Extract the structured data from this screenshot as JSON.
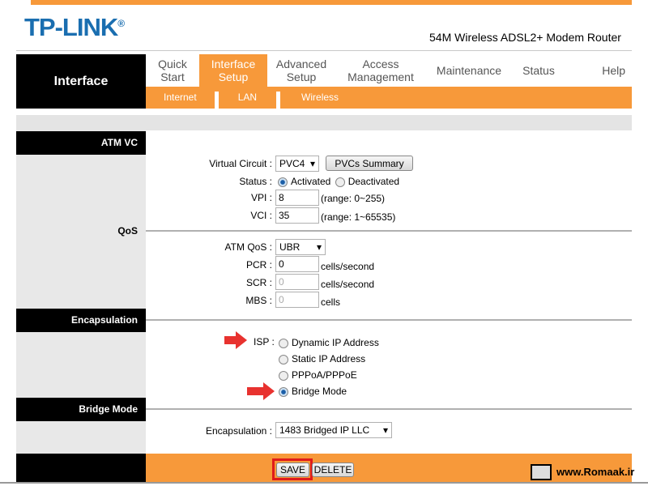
{
  "header": {
    "logo": "TP-LINK",
    "registered": "®",
    "subtitle": "54M Wireless ADSL2+ Modem Router"
  },
  "nav": {
    "section": "Interface",
    "tabs": [
      {
        "line1": "Quick",
        "line2": "Start"
      },
      {
        "line1": "Interface",
        "line2": "Setup"
      },
      {
        "line1": "Advanced",
        "line2": "Setup"
      },
      {
        "line1": "Access",
        "line2": "Management"
      },
      {
        "line1": "Maintenance",
        "line2": ""
      },
      {
        "line1": "Status",
        "line2": ""
      },
      {
        "line1": "Help",
        "line2": ""
      }
    ],
    "subtabs": [
      "Internet",
      "LAN",
      "Wireless"
    ]
  },
  "sections": {
    "atmvc": "ATM VC",
    "qos": "QoS",
    "encapsulation": "Encapsulation",
    "bridge": "Bridge Mode"
  },
  "atmvc": {
    "vc_label": "Virtual Circuit :",
    "vc_value": "PVC4",
    "pvcs_button": "PVCs Summary",
    "status_label": "Status :",
    "activated": "Activated",
    "deactivated": "Deactivated",
    "vpi_label": "VPI :",
    "vpi": "8",
    "vpi_range": "(range: 0~255)",
    "vci_label": "VCI :",
    "vci": "35",
    "vci_range": "(range: 1~65535)"
  },
  "qos": {
    "atmqos_label": "ATM QoS :",
    "atmqos": "UBR",
    "pcr_label": "PCR :",
    "pcr": "0",
    "scr_label": "SCR :",
    "scr": "0",
    "mbs_label": "MBS :",
    "mbs": "0",
    "unit_cps": "cells/second",
    "unit_cells": "cells"
  },
  "isp": {
    "label": "ISP :",
    "options": [
      "Dynamic IP Address",
      "Static IP Address",
      "PPPoA/PPPoE",
      "Bridge Mode"
    ],
    "selected": "Bridge Mode"
  },
  "bridge": {
    "encap_label": "Encapsulation :",
    "encap_value": "1483 Bridged IP LLC"
  },
  "footer": {
    "save": "SAVE",
    "delete": "DELETE",
    "watermark": "www.Romaak.ir"
  },
  "colors": {
    "accent": "#f7993a",
    "logo": "#1a6eb0",
    "highlight": "#e8322f"
  }
}
